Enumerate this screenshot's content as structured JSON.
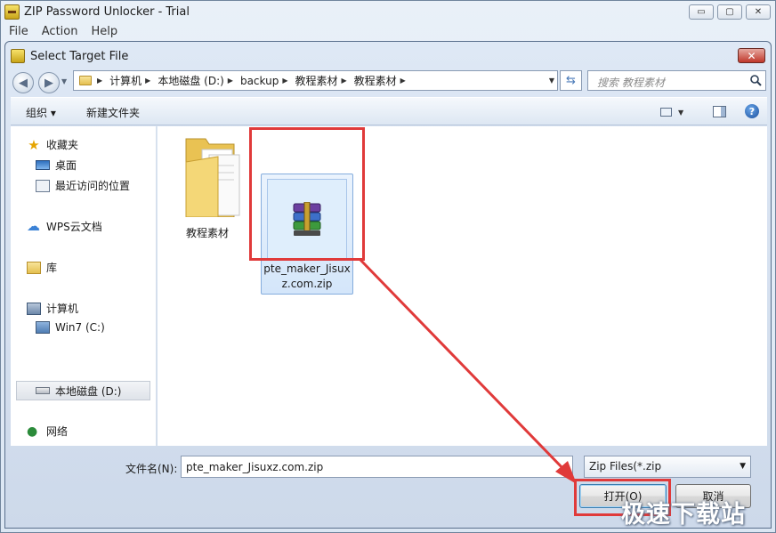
{
  "window": {
    "title": "ZIP Password Unlocker - Trial",
    "controls": {
      "minimize": "▭",
      "maximize": "▢",
      "close": "✕"
    }
  },
  "menubar": {
    "items": [
      "File",
      "Action",
      "Help"
    ]
  },
  "dialog": {
    "title": "Select Target File",
    "close_glyph": "✕",
    "breadcrumb": [
      "计算机",
      "本地磁盘 (D:)",
      "backup",
      "教程素材",
      "教程素材"
    ],
    "search_placeholder": "搜索 教程素材",
    "toolbar": {
      "organize": "组织 ▾",
      "new_folder": "新建文件夹",
      "help": "?"
    },
    "sidebar": {
      "favorites": "收藏夹",
      "desktop": "桌面",
      "recent": "最近访问的位置",
      "wps": "WPS云文档",
      "libraries": "库",
      "computer": "计算机",
      "drive_c": "Win7 (C:)",
      "drive_d": "本地磁盘 (D:)",
      "network": "网络"
    },
    "files": [
      {
        "name": "教程素材",
        "kind": "folder"
      },
      {
        "name": "pte_maker_Jisuxz.com.zip",
        "kind": "zip",
        "selected": true
      }
    ],
    "filename_label": "文件名(N):",
    "filename_value": "pte_maker_Jisuxz.com.zip",
    "filetype_value": "Zip Files(*.zip",
    "open_button": "打开(O)",
    "cancel_button": "取消"
  },
  "watermark": "极速下载站",
  "colors": {
    "highlight_red": "#e03a3a",
    "selection_blue": "#d4e6fa",
    "accent": "#3c7fb1"
  }
}
